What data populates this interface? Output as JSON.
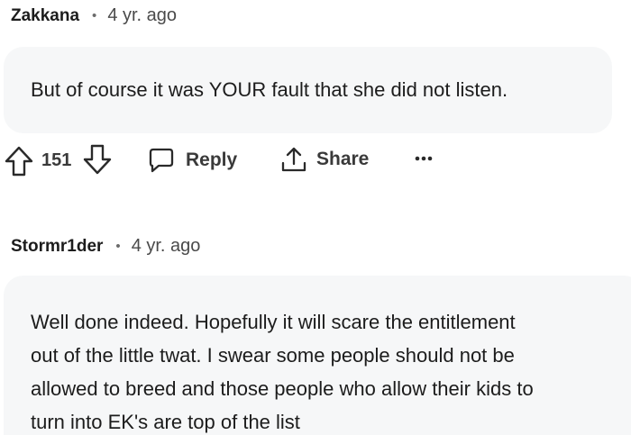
{
  "comments": [
    {
      "author": "Zakkana",
      "separator": "•",
      "time": "4 yr. ago",
      "body": "But of course it was YOUR fault that she did not listen.",
      "score": "151",
      "reply_label": "Reply",
      "share_label": "Share",
      "more_label": "···"
    },
    {
      "author": "Stormr1der",
      "separator": "•",
      "time": "4 yr. ago",
      "body_lines": [
        "Well done indeed. Hopefully it will scare the entitlement",
        "out of the little twat. I swear some people should not be",
        "allowed to breed and those people who allow their kids to",
        "turn into EK's are top of the list"
      ]
    }
  ],
  "icons": {
    "upvote": "upvote-arrow-icon",
    "downvote": "downvote-arrow-icon",
    "reply": "speech-bubble-icon",
    "share": "share-upload-icon",
    "more": "ellipsis-icon"
  }
}
